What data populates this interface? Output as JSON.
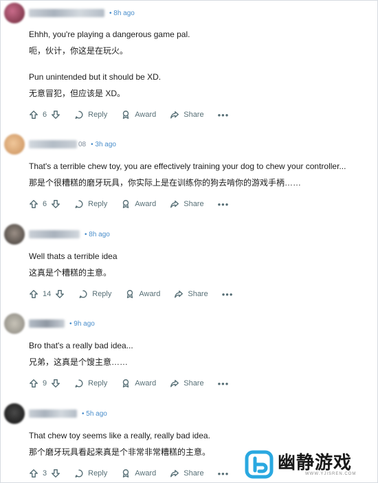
{
  "colors": {
    "timestamp": "#4a8ecb",
    "action": "#576f76",
    "text": "#1c1c1c",
    "watermark_accent": "#2aa8e0"
  },
  "comments": [
    {
      "time": "• 8h ago",
      "lines": [
        "Ehhh, you're playing a dangerous game pal.",
        "呃，伙计，你这是在玩火。",
        "Pun unintended but it should be XD.",
        "无意冒犯，但应该是 XD。"
      ],
      "votes": "6",
      "reply": "Reply",
      "award": "Award",
      "share": "Share",
      "more": "•••"
    },
    {
      "time": "• 3h ago",
      "username_visible_suffix": "08",
      "lines": [
        "That's a terrible chew toy, you are effectively training your dog to chew your controller...",
        "那是个很糟糕的磨牙玩具，你实际上是在训练你的狗去啃你的游戏手柄……"
      ],
      "votes": "6",
      "reply": "Reply",
      "award": "Award",
      "share": "Share",
      "more": "•••"
    },
    {
      "time": "• 8h ago",
      "lines": [
        "Well thats a terrible idea",
        "这真是个糟糕的主意。"
      ],
      "votes": "14",
      "reply": "Reply",
      "award": "Award",
      "share": "Share",
      "more": "•••"
    },
    {
      "time": "• 9h ago",
      "lines": [
        "Bro that's a really bad idea...",
        "兄弟，这真是个馊主意……"
      ],
      "votes": "9",
      "reply": "Reply",
      "award": "Award",
      "share": "Share",
      "more": "•••"
    },
    {
      "time": "• 5h ago",
      "lines": [
        "That chew toy seems like a really, really bad idea.",
        "那个磨牙玩具看起来真是个非常非常糟糕的主意。"
      ],
      "votes": "3",
      "reply": "Reply",
      "award": "Award",
      "share": "Share",
      "more": "•••"
    }
  ],
  "watermark": {
    "name": "幽静游戏",
    "url": "WWW.YJISREN.COM"
  }
}
